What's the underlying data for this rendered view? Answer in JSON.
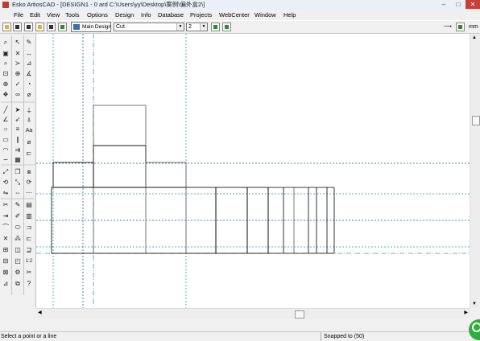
{
  "window": {
    "title": "Esko ArtiosCAD - [DESIGN1 - 0 ard C:\\Users\\yy\\Desktop\\案例\\偏外盒2\\]",
    "minimize_label": "–",
    "maximize_label": "□",
    "close_label": "✕"
  },
  "menubar": {
    "items": [
      "File",
      "Edit",
      "View",
      "Tools",
      "Options",
      "Design",
      "Info",
      "Database",
      "Projects",
      "WebCenter",
      "Window",
      "Help"
    ],
    "mdi_minimize": "–",
    "mdi_restore": "▫",
    "mdi_close": "x"
  },
  "toolbar": {
    "main_design_label": "Main Design",
    "linetype_value": "Cut",
    "pointsize_value": "2",
    "right_label": "mm"
  },
  "status": {
    "prompt": "Select a point or a line",
    "snap": "Snapped to (50)"
  },
  "colors": {
    "guide_teal": "#2aa3b0",
    "guide_blue": "#1e5fa0",
    "line": "#000000"
  },
  "icons": {
    "app": "esko-logo-icon",
    "help": "question-mark-icon",
    "badge": "green-status-badge-icon"
  }
}
